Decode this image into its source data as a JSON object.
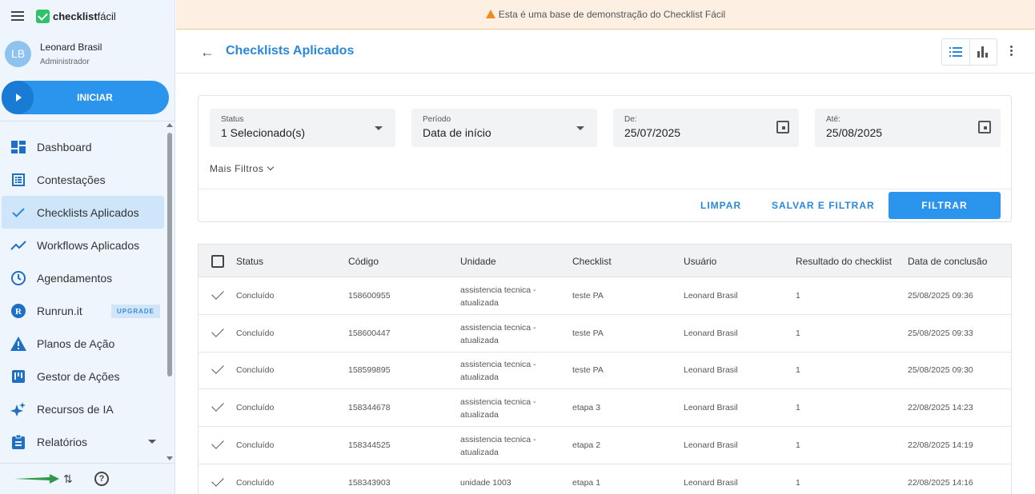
{
  "app": {
    "logo_bold": "checklist",
    "logo_light": "fácil"
  },
  "user": {
    "initials": "LB",
    "name": "Leonard Brasil",
    "role": "Administrador"
  },
  "start_button": "INICIAR",
  "nav": [
    {
      "label": "Dashboard",
      "icon": "dashboard-icon"
    },
    {
      "label": "Contestações",
      "icon": "list-icon"
    },
    {
      "label": "Checklists Aplicados",
      "icon": "check-icon",
      "active": true
    },
    {
      "label": "Workflows Aplicados",
      "icon": "trend-icon"
    },
    {
      "label": "Agendamentos",
      "icon": "clock-icon"
    },
    {
      "label": "Runrun.it",
      "icon": "runrun-icon",
      "badge": "UPGRADE"
    },
    {
      "label": "Planos de Ação",
      "icon": "warning-icon"
    },
    {
      "label": "Gestor de Ações",
      "icon": "board-icon"
    },
    {
      "label": "Recursos de IA",
      "icon": "sparkle-icon"
    },
    {
      "label": "Relatórios",
      "icon": "clipboard-icon"
    }
  ],
  "banner": "Esta é uma base de demonstração do Checklist Fácil",
  "page_title": "Checklists Aplicados",
  "filters": {
    "status_label": "Status",
    "status_value": "1 Selecionado(s)",
    "period_label": "Período",
    "period_value": "Data de início",
    "from_label": "De:",
    "from_value": "25/07/2025",
    "to_label": "Até:",
    "to_value": "25/08/2025",
    "more": "Mais Filtros",
    "clear": "LIMPAR",
    "save_filter": "SALVAR E FILTRAR",
    "filter": "FILTRAR"
  },
  "table": {
    "columns": [
      "Status",
      "Código",
      "Unidade",
      "Checklist",
      "Usuário",
      "Resultado do checklist",
      "Data de conclusão"
    ],
    "rows": [
      {
        "status": "Concluído",
        "code": "158600955",
        "unit": "assistencia tecnica - atualizada",
        "checklist": "teste PA",
        "user": "Leonard Brasil",
        "result": "1",
        "date": "25/08/2025 09:36"
      },
      {
        "status": "Concluído",
        "code": "158600447",
        "unit": "assistencia tecnica - atualizada",
        "checklist": "teste PA",
        "user": "Leonard Brasil",
        "result": "1",
        "date": "25/08/2025 09:33"
      },
      {
        "status": "Concluído",
        "code": "158599895",
        "unit": "assistencia tecnica - atualizada",
        "checklist": "teste PA",
        "user": "Leonard Brasil",
        "result": "1",
        "date": "25/08/2025 09:30"
      },
      {
        "status": "Concluído",
        "code": "158344678",
        "unit": "assistencia tecnica - atualizada",
        "checklist": "etapa 3",
        "user": "Leonard Brasil",
        "result": "1",
        "date": "22/08/2025 14:23"
      },
      {
        "status": "Concluído",
        "code": "158344525",
        "unit": "assistencia tecnica - atualizada",
        "checklist": "etapa 2",
        "user": "Leonard Brasil",
        "result": "1",
        "date": "22/08/2025 14:19"
      },
      {
        "status": "Concluído",
        "code": "158343903",
        "unit": "unidade 1003",
        "checklist": "etapa 1",
        "user": "Leonard Brasil",
        "result": "1",
        "date": "22/08/2025 14:16"
      }
    ]
  },
  "colors": {
    "primary": "#2b95ee",
    "title": "#2b87dc",
    "sidebar_bg": "#eef5fc",
    "banner_bg": "#fdf0e3",
    "logo_green": "#2ec26a"
  }
}
